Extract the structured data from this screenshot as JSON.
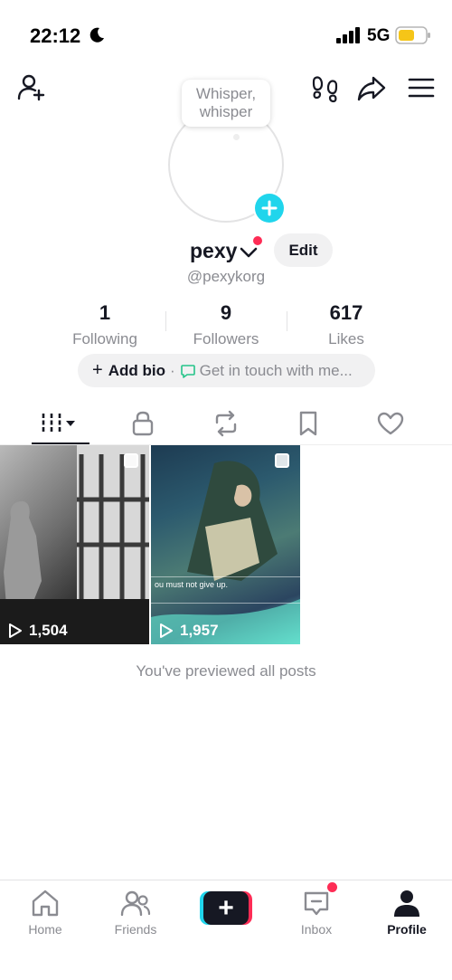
{
  "status_bar": {
    "time": "22:12",
    "network": "5G"
  },
  "whisper": {
    "text": "Whisper, whisper"
  },
  "profile": {
    "name": "pexy",
    "handle": "@pexykorg",
    "edit_label": "Edit"
  },
  "stats": [
    {
      "value": "1",
      "label": "Following"
    },
    {
      "value": "9",
      "label": "Followers"
    },
    {
      "value": "617",
      "label": "Likes"
    }
  ],
  "bio": {
    "plus": "+",
    "add_bio": "Add bio",
    "separator": "·",
    "touch": "Get in touch with me..."
  },
  "tabs": [
    {
      "icon": "videos-grid-icon"
    },
    {
      "icon": "lock-icon"
    },
    {
      "icon": "repost-icon"
    },
    {
      "icon": "bookmark-icon"
    },
    {
      "icon": "heart-icon"
    }
  ],
  "videos": [
    {
      "plays": "1,504"
    },
    {
      "plays": "1,957",
      "caption": "ou must not give up."
    }
  ],
  "footer_text": "You've previewed all posts",
  "bottom_nav": {
    "home": "Home",
    "friends": "Friends",
    "create": "+",
    "inbox": "Inbox",
    "profile": "Profile"
  },
  "colors": {
    "accent_red": "#fe2c55",
    "accent_cyan": "#20d5ec",
    "text_primary": "#161823",
    "text_secondary": "#8a8b91"
  }
}
